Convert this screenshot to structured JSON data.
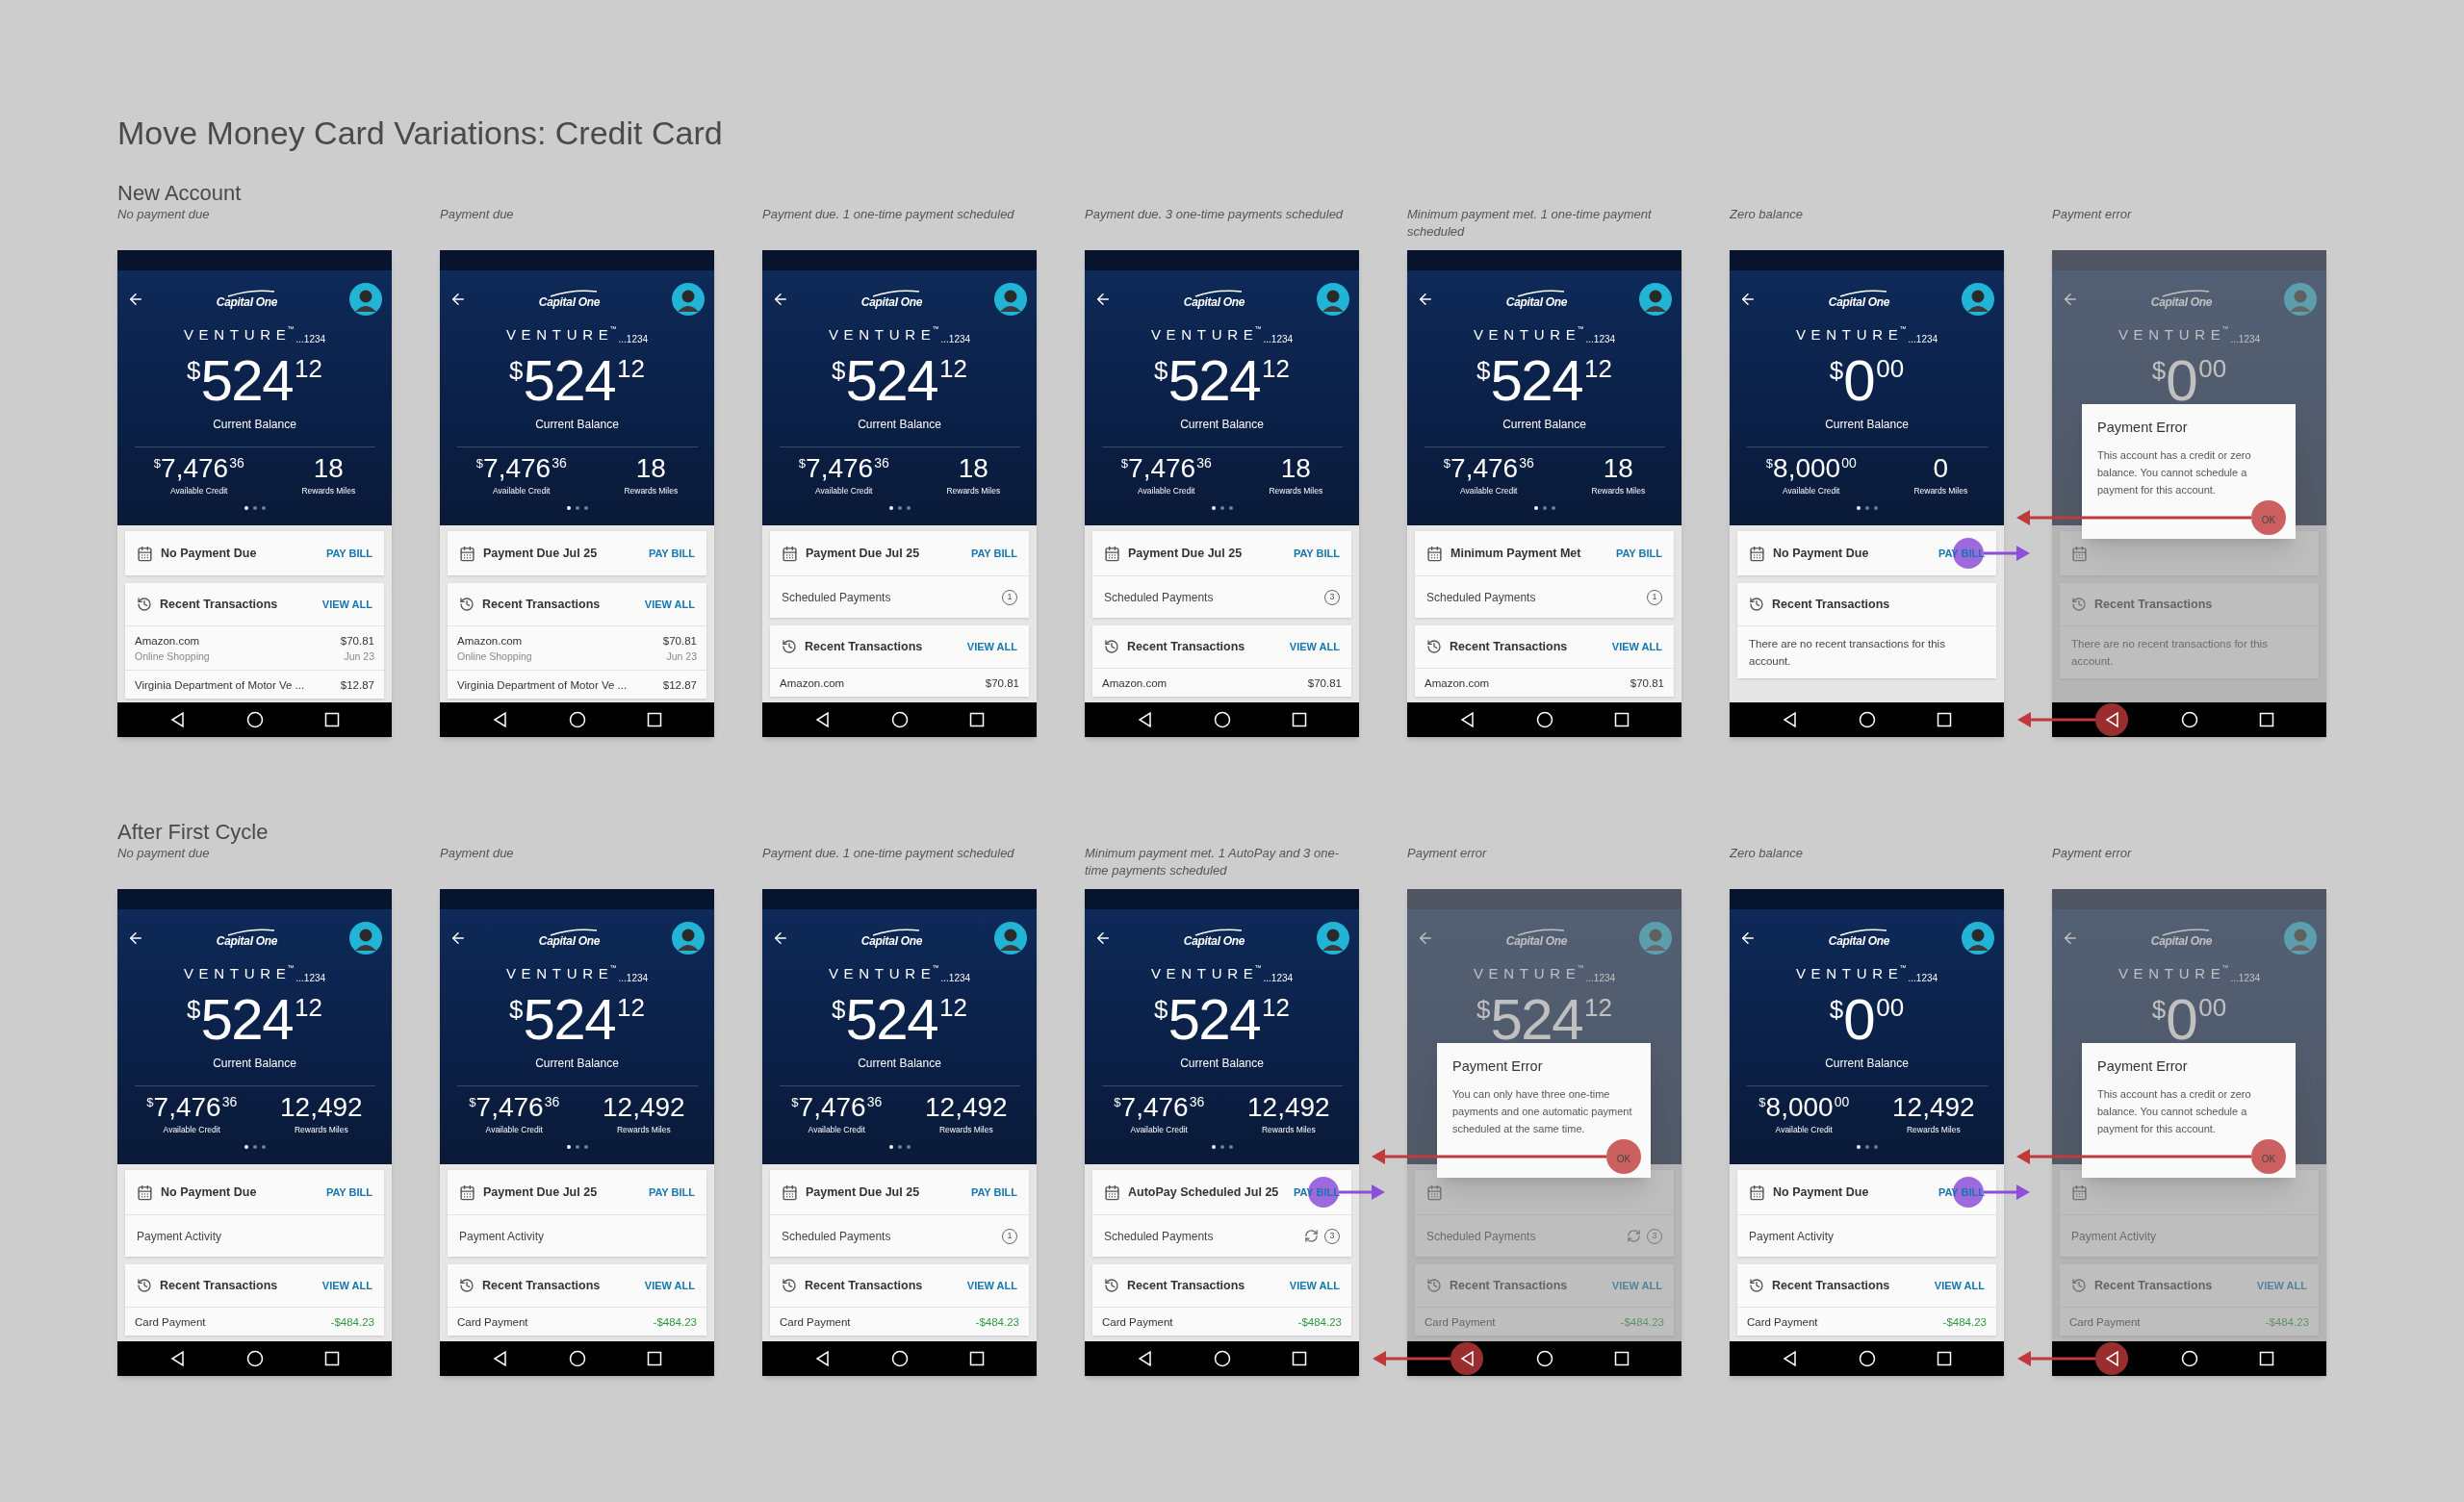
{
  "title": "Move Money Card Variations: Credit Card",
  "sections": [
    {
      "heading": "New Account",
      "screens": [
        {
          "caption": "No payment due",
          "phone": {
            "logo": "Capital One",
            "card_name": "VENTURE",
            "trademark": "™",
            "last4": "...1234",
            "balance": {
              "currency": "$",
              "whole": "524",
              "cents": "12"
            },
            "balance_label": "Current Balance",
            "credit": {
              "currency": "$",
              "whole": "7,476",
              "cents": "36"
            },
            "credit_label": "Available Credit",
            "miles": "18",
            "miles_label": "Rewards Miles",
            "pager": [
              {
                "selected": true
              },
              {
                "selected": false
              },
              {
                "selected": false
              }
            ],
            "back_tapped": false,
            "cards": [
              {
                "rows": [
                  {
                    "kind": "status",
                    "label": "No Payment Due",
                    "action": "PAY BILL",
                    "tapped": false
                  }
                ]
              },
              {
                "rows": [
                  {
                    "kind": "header",
                    "label": "Recent Transactions",
                    "action": "VIEW ALL"
                  },
                  {
                    "kind": "transaction",
                    "name": "Amazon.com",
                    "amount": "$70.81",
                    "detail": "Online Shopping",
                    "date": "Jun 23",
                    "is_payment": false
                  },
                  {
                    "kind": "transaction",
                    "name": "Virginia Department of Motor Ve ...",
                    "amount": "$12.87",
                    "is_payment": false
                  }
                ]
              }
            ]
          }
        },
        {
          "caption": "Payment due",
          "phone": {
            "logo": "Capital One",
            "card_name": "VENTURE",
            "trademark": "™",
            "last4": "...1234",
            "balance": {
              "currency": "$",
              "whole": "524",
              "cents": "12"
            },
            "balance_label": "Current Balance",
            "credit": {
              "currency": "$",
              "whole": "7,476",
              "cents": "36"
            },
            "credit_label": "Available Credit",
            "miles": "18",
            "miles_label": "Rewards Miles",
            "pager": [
              {
                "selected": true
              },
              {
                "selected": false
              },
              {
                "selected": false
              }
            ],
            "back_tapped": false,
            "cards": [
              {
                "rows": [
                  {
                    "kind": "status",
                    "label": "Payment Due Jul 25",
                    "action": "PAY BILL",
                    "tapped": false
                  }
                ]
              },
              {
                "rows": [
                  {
                    "kind": "header",
                    "label": "Recent Transactions",
                    "action": "VIEW ALL"
                  },
                  {
                    "kind": "transaction",
                    "name": "Amazon.com",
                    "amount": "$70.81",
                    "detail": "Online Shopping",
                    "date": "Jun 23",
                    "is_payment": false
                  },
                  {
                    "kind": "transaction",
                    "name": "Virginia Department of Motor Ve ...",
                    "amount": "$12.87",
                    "is_payment": false
                  }
                ]
              }
            ]
          }
        },
        {
          "caption": "Payment due. 1 one-time payment scheduled",
          "phone": {
            "logo": "Capital One",
            "card_name": "VENTURE",
            "trademark": "™",
            "last4": "...1234",
            "balance": {
              "currency": "$",
              "whole": "524",
              "cents": "12"
            },
            "balance_label": "Current Balance",
            "credit": {
              "currency": "$",
              "whole": "7,476",
              "cents": "36"
            },
            "credit_label": "Available Credit",
            "miles": "18",
            "miles_label": "Rewards Miles",
            "pager": [
              {
                "selected": true
              },
              {
                "selected": false
              },
              {
                "selected": false
              }
            ],
            "back_tapped": false,
            "cards": [
              {
                "rows": [
                  {
                    "kind": "status",
                    "label": "Payment Due Jul 25",
                    "action": "PAY BILL",
                    "tapped": false
                  },
                  {
                    "kind": "scheduled",
                    "label": "Scheduled Payments",
                    "count": "1",
                    "autopay": false
                  }
                ]
              },
              {
                "rows": [
                  {
                    "kind": "header",
                    "label": "Recent Transactions",
                    "action": "VIEW ALL"
                  },
                  {
                    "kind": "transaction",
                    "name": "Amazon.com",
                    "amount": "$70.81",
                    "is_payment": false
                  }
                ]
              }
            ]
          }
        },
        {
          "caption": "Payment due. 3 one-time payments scheduled",
          "phone": {
            "logo": "Capital One",
            "card_name": "VENTURE",
            "trademark": "™",
            "last4": "...1234",
            "balance": {
              "currency": "$",
              "whole": "524",
              "cents": "12"
            },
            "balance_label": "Current Balance",
            "credit": {
              "currency": "$",
              "whole": "7,476",
              "cents": "36"
            },
            "credit_label": "Available Credit",
            "miles": "18",
            "miles_label": "Rewards Miles",
            "pager": [
              {
                "selected": true
              },
              {
                "selected": false
              },
              {
                "selected": false
              }
            ],
            "back_tapped": false,
            "cards": [
              {
                "rows": [
                  {
                    "kind": "status",
                    "label": "Payment Due Jul 25",
                    "action": "PAY BILL",
                    "tapped": false
                  },
                  {
                    "kind": "scheduled",
                    "label": "Scheduled Payments",
                    "count": "3",
                    "autopay": false
                  }
                ]
              },
              {
                "rows": [
                  {
                    "kind": "header",
                    "label": "Recent Transactions",
                    "action": "VIEW ALL"
                  },
                  {
                    "kind": "transaction",
                    "name": "Amazon.com",
                    "amount": "$70.81",
                    "is_payment": false
                  }
                ]
              }
            ]
          }
        },
        {
          "caption": "Minimum payment met. 1 one-time payment scheduled",
          "phone": {
            "logo": "Capital One",
            "card_name": "VENTURE",
            "trademark": "™",
            "last4": "...1234",
            "balance": {
              "currency": "$",
              "whole": "524",
              "cents": "12"
            },
            "balance_label": "Current Balance",
            "credit": {
              "currency": "$",
              "whole": "7,476",
              "cents": "36"
            },
            "credit_label": "Available Credit",
            "miles": "18",
            "miles_label": "Rewards Miles",
            "pager": [
              {
                "selected": true
              },
              {
                "selected": false
              },
              {
                "selected": false
              }
            ],
            "back_tapped": false,
            "cards": [
              {
                "rows": [
                  {
                    "kind": "status",
                    "label": "Minimum Payment Met",
                    "action": "PAY BILL",
                    "tapped": false
                  },
                  {
                    "kind": "scheduled",
                    "label": "Scheduled Payments",
                    "count": "1",
                    "autopay": false
                  }
                ]
              },
              {
                "rows": [
                  {
                    "kind": "header",
                    "label": "Recent Transactions",
                    "action": "VIEW ALL"
                  },
                  {
                    "kind": "transaction",
                    "name": "Amazon.com",
                    "amount": "$70.81",
                    "is_payment": false
                  }
                ]
              }
            ]
          }
        },
        {
          "caption": "Zero balance",
          "phone": {
            "logo": "Capital One",
            "card_name": "VENTURE",
            "trademark": "™",
            "last4": "...1234",
            "balance": {
              "currency": "$",
              "whole": "0",
              "cents": "00"
            },
            "balance_label": "Current Balance",
            "credit": {
              "currency": "$",
              "whole": "8,000",
              "cents": "00"
            },
            "credit_label": "Available Credit",
            "miles": "0",
            "miles_label": "Rewards Miles",
            "pager": [
              {
                "selected": true
              },
              {
                "selected": false
              },
              {
                "selected": false
              }
            ],
            "back_tapped": false,
            "cards": [
              {
                "rows": [
                  {
                    "kind": "status",
                    "label": "No Payment Due",
                    "action": "PAY BILL",
                    "tapped": true
                  }
                ]
              },
              {
                "rows": [
                  {
                    "kind": "header",
                    "label": "Recent Transactions"
                  },
                  {
                    "kind": "message",
                    "text": "There are no recent transactions for this account."
                  }
                ]
              }
            ]
          }
        },
        {
          "caption": "Payment error",
          "phone": {
            "logo": "Capital One",
            "card_name": "VENTURE",
            "trademark": "™",
            "last4": "...1234",
            "balance": {
              "currency": "$",
              "whole": "0",
              "cents": "00"
            },
            "back_tapped": true,
            "cards": [
              {
                "rows": [
                  {
                    "kind": "status",
                    "tapped": false
                  }
                ]
              },
              {
                "rows": [
                  {
                    "kind": "header",
                    "label": "Recent Transactions"
                  },
                  {
                    "kind": "message",
                    "text": "There are no recent transactions for this account."
                  }
                ]
              }
            ],
            "dialog": {
              "title": "Payment Error",
              "text": "This account has a credit or zero balance. You cannot schedule a payment for this account.",
              "button": "OK",
              "tapped": true
            }
          }
        }
      ]
    },
    {
      "heading": "After First Cycle",
      "screens": [
        {
          "caption": "No payment due",
          "phone": {
            "logo": "Capital One",
            "card_name": "VENTURE",
            "trademark": "™",
            "last4": "...1234",
            "balance": {
              "currency": "$",
              "whole": "524",
              "cents": "12"
            },
            "balance_label": "Current Balance",
            "credit": {
              "currency": "$",
              "whole": "7,476",
              "cents": "36"
            },
            "credit_label": "Available Credit",
            "miles": "12,492",
            "miles_label": "Rewards Miles",
            "pager": [
              {
                "selected": true
              },
              {
                "selected": false
              },
              {
                "selected": false
              }
            ],
            "back_tapped": false,
            "cards": [
              {
                "rows": [
                  {
                    "kind": "status",
                    "label": "No Payment Due",
                    "action": "PAY BILL",
                    "tapped": false
                  },
                  {
                    "kind": "plain",
                    "label": "Payment Activity"
                  }
                ]
              },
              {
                "rows": [
                  {
                    "kind": "header",
                    "label": "Recent Transactions",
                    "action": "VIEW ALL"
                  },
                  {
                    "kind": "transaction",
                    "name": "Card Payment",
                    "amount": "-$484.23",
                    "is_payment": true
                  }
                ]
              }
            ]
          }
        },
        {
          "caption": "Payment due",
          "phone": {
            "logo": "Capital One",
            "card_name": "VENTURE",
            "trademark": "™",
            "last4": "...1234",
            "balance": {
              "currency": "$",
              "whole": "524",
              "cents": "12"
            },
            "balance_label": "Current Balance",
            "credit": {
              "currency": "$",
              "whole": "7,476",
              "cents": "36"
            },
            "credit_label": "Available Credit",
            "miles": "12,492",
            "miles_label": "Rewards Miles",
            "pager": [
              {
                "selected": true
              },
              {
                "selected": false
              },
              {
                "selected": false
              }
            ],
            "back_tapped": false,
            "cards": [
              {
                "rows": [
                  {
                    "kind": "status",
                    "label": "Payment Due Jul 25",
                    "action": "PAY BILL",
                    "tapped": false
                  },
                  {
                    "kind": "plain",
                    "label": "Payment Activity"
                  }
                ]
              },
              {
                "rows": [
                  {
                    "kind": "header",
                    "label": "Recent Transactions",
                    "action": "VIEW ALL"
                  },
                  {
                    "kind": "transaction",
                    "name": "Card Payment",
                    "amount": "-$484.23",
                    "is_payment": true
                  }
                ]
              }
            ]
          }
        },
        {
          "caption": "Payment due. 1 one-time payment scheduled",
          "phone": {
            "logo": "Capital One",
            "card_name": "VENTURE",
            "trademark": "™",
            "last4": "...1234",
            "balance": {
              "currency": "$",
              "whole": "524",
              "cents": "12"
            },
            "balance_label": "Current Balance",
            "credit": {
              "currency": "$",
              "whole": "7,476",
              "cents": "36"
            },
            "credit_label": "Available Credit",
            "miles": "12,492",
            "miles_label": "Rewards Miles",
            "pager": [
              {
                "selected": true
              },
              {
                "selected": false
              },
              {
                "selected": false
              }
            ],
            "back_tapped": false,
            "cards": [
              {
                "rows": [
                  {
                    "kind": "status",
                    "label": "Payment Due Jul 25",
                    "action": "PAY BILL",
                    "tapped": false
                  },
                  {
                    "kind": "scheduled",
                    "label": "Scheduled Payments",
                    "count": "1",
                    "autopay": false
                  }
                ]
              },
              {
                "rows": [
                  {
                    "kind": "header",
                    "label": "Recent Transactions",
                    "action": "VIEW ALL"
                  },
                  {
                    "kind": "transaction",
                    "name": "Card Payment",
                    "amount": "-$484.23",
                    "is_payment": true
                  }
                ]
              }
            ]
          }
        },
        {
          "caption": "Minimum payment met. 1 AutoPay and 3 one-time payments scheduled",
          "phone": {
            "logo": "Capital One",
            "card_name": "VENTURE",
            "trademark": "™",
            "last4": "...1234",
            "balance": {
              "currency": "$",
              "whole": "524",
              "cents": "12"
            },
            "balance_label": "Current Balance",
            "credit": {
              "currency": "$",
              "whole": "7,476",
              "cents": "36"
            },
            "credit_label": "Available Credit",
            "miles": "12,492",
            "miles_label": "Rewards Miles",
            "pager": [
              {
                "selected": true
              },
              {
                "selected": false
              },
              {
                "selected": false
              }
            ],
            "back_tapped": false,
            "cards": [
              {
                "rows": [
                  {
                    "kind": "status",
                    "label": "AutoPay Scheduled Jul 25",
                    "action": "PAY BILL",
                    "tapped": true
                  },
                  {
                    "kind": "scheduled",
                    "label": "Scheduled Payments",
                    "count": "3",
                    "autopay": true
                  }
                ]
              },
              {
                "rows": [
                  {
                    "kind": "header",
                    "label": "Recent Transactions",
                    "action": "VIEW ALL"
                  },
                  {
                    "kind": "transaction",
                    "name": "Card Payment",
                    "amount": "-$484.23",
                    "is_payment": true
                  }
                ]
              }
            ]
          }
        },
        {
          "caption": "Payment error",
          "phone": {
            "logo": "Capital One",
            "card_name": "VENTURE",
            "trademark": "™",
            "last4": "...1234",
            "balance": {
              "currency": "$",
              "whole": "524",
              "cents": "12"
            },
            "back_tapped": true,
            "cards": [
              {
                "rows": [
                  {
                    "kind": "status",
                    "tapped": false
                  },
                  {
                    "kind": "scheduled",
                    "label": "Scheduled Payments",
                    "count": "3",
                    "autopay": true
                  }
                ]
              },
              {
                "rows": [
                  {
                    "kind": "header",
                    "label": "Recent Transactions",
                    "action": "VIEW ALL"
                  },
                  {
                    "kind": "transaction",
                    "name": "Card Payment",
                    "amount": "-$484.23",
                    "is_payment": true
                  }
                ]
              }
            ],
            "dialog": {
              "title": "Payment Error",
              "text": "You can only have three one-time payments and one automatic payment scheduled at the same time.",
              "button": "OK",
              "tapped": true
            }
          }
        },
        {
          "caption": "Zero balance",
          "phone": {
            "logo": "Capital One",
            "card_name": "VENTURE",
            "trademark": "™",
            "last4": "...1234",
            "balance": {
              "currency": "$",
              "whole": "0",
              "cents": "00"
            },
            "balance_label": "Current Balance",
            "credit": {
              "currency": "$",
              "whole": "8,000",
              "cents": "00"
            },
            "credit_label": "Available Credit",
            "miles": "12,492",
            "miles_label": "Rewards Miles",
            "pager": [
              {
                "selected": true
              },
              {
                "selected": false
              },
              {
                "selected": false
              }
            ],
            "back_tapped": false,
            "cards": [
              {
                "rows": [
                  {
                    "kind": "status",
                    "label": "No Payment Due",
                    "action": "PAY BILL",
                    "tapped": true
                  },
                  {
                    "kind": "plain",
                    "label": "Payment Activity"
                  }
                ]
              },
              {
                "rows": [
                  {
                    "kind": "header",
                    "label": "Recent Transactions",
                    "action": "VIEW ALL"
                  },
                  {
                    "kind": "transaction",
                    "name": "Card Payment",
                    "amount": "-$484.23",
                    "is_payment": true
                  }
                ]
              }
            ]
          }
        },
        {
          "caption": "Payment error",
          "phone": {
            "logo": "Capital One",
            "card_name": "VENTURE",
            "trademark": "™",
            "last4": "...1234",
            "balance": {
              "currency": "$",
              "whole": "0",
              "cents": "00"
            },
            "back_tapped": true,
            "cards": [
              {
                "rows": [
                  {
                    "kind": "status",
                    "tapped": false
                  },
                  {
                    "kind": "plain",
                    "label": "Payment Activity"
                  }
                ]
              },
              {
                "rows": [
                  {
                    "kind": "header",
                    "label": "Recent Transactions",
                    "action": "VIEW ALL"
                  },
                  {
                    "kind": "transaction",
                    "name": "Card Payment",
                    "amount": "-$484.23",
                    "is_payment": true
                  }
                ]
              }
            ],
            "dialog": {
              "title": "Payment Error",
              "text": "This account has a credit or zero balance. You cannot schedule a payment for this account.",
              "button": "OK",
              "tapped": true
            }
          }
        }
      ]
    }
  ]
}
